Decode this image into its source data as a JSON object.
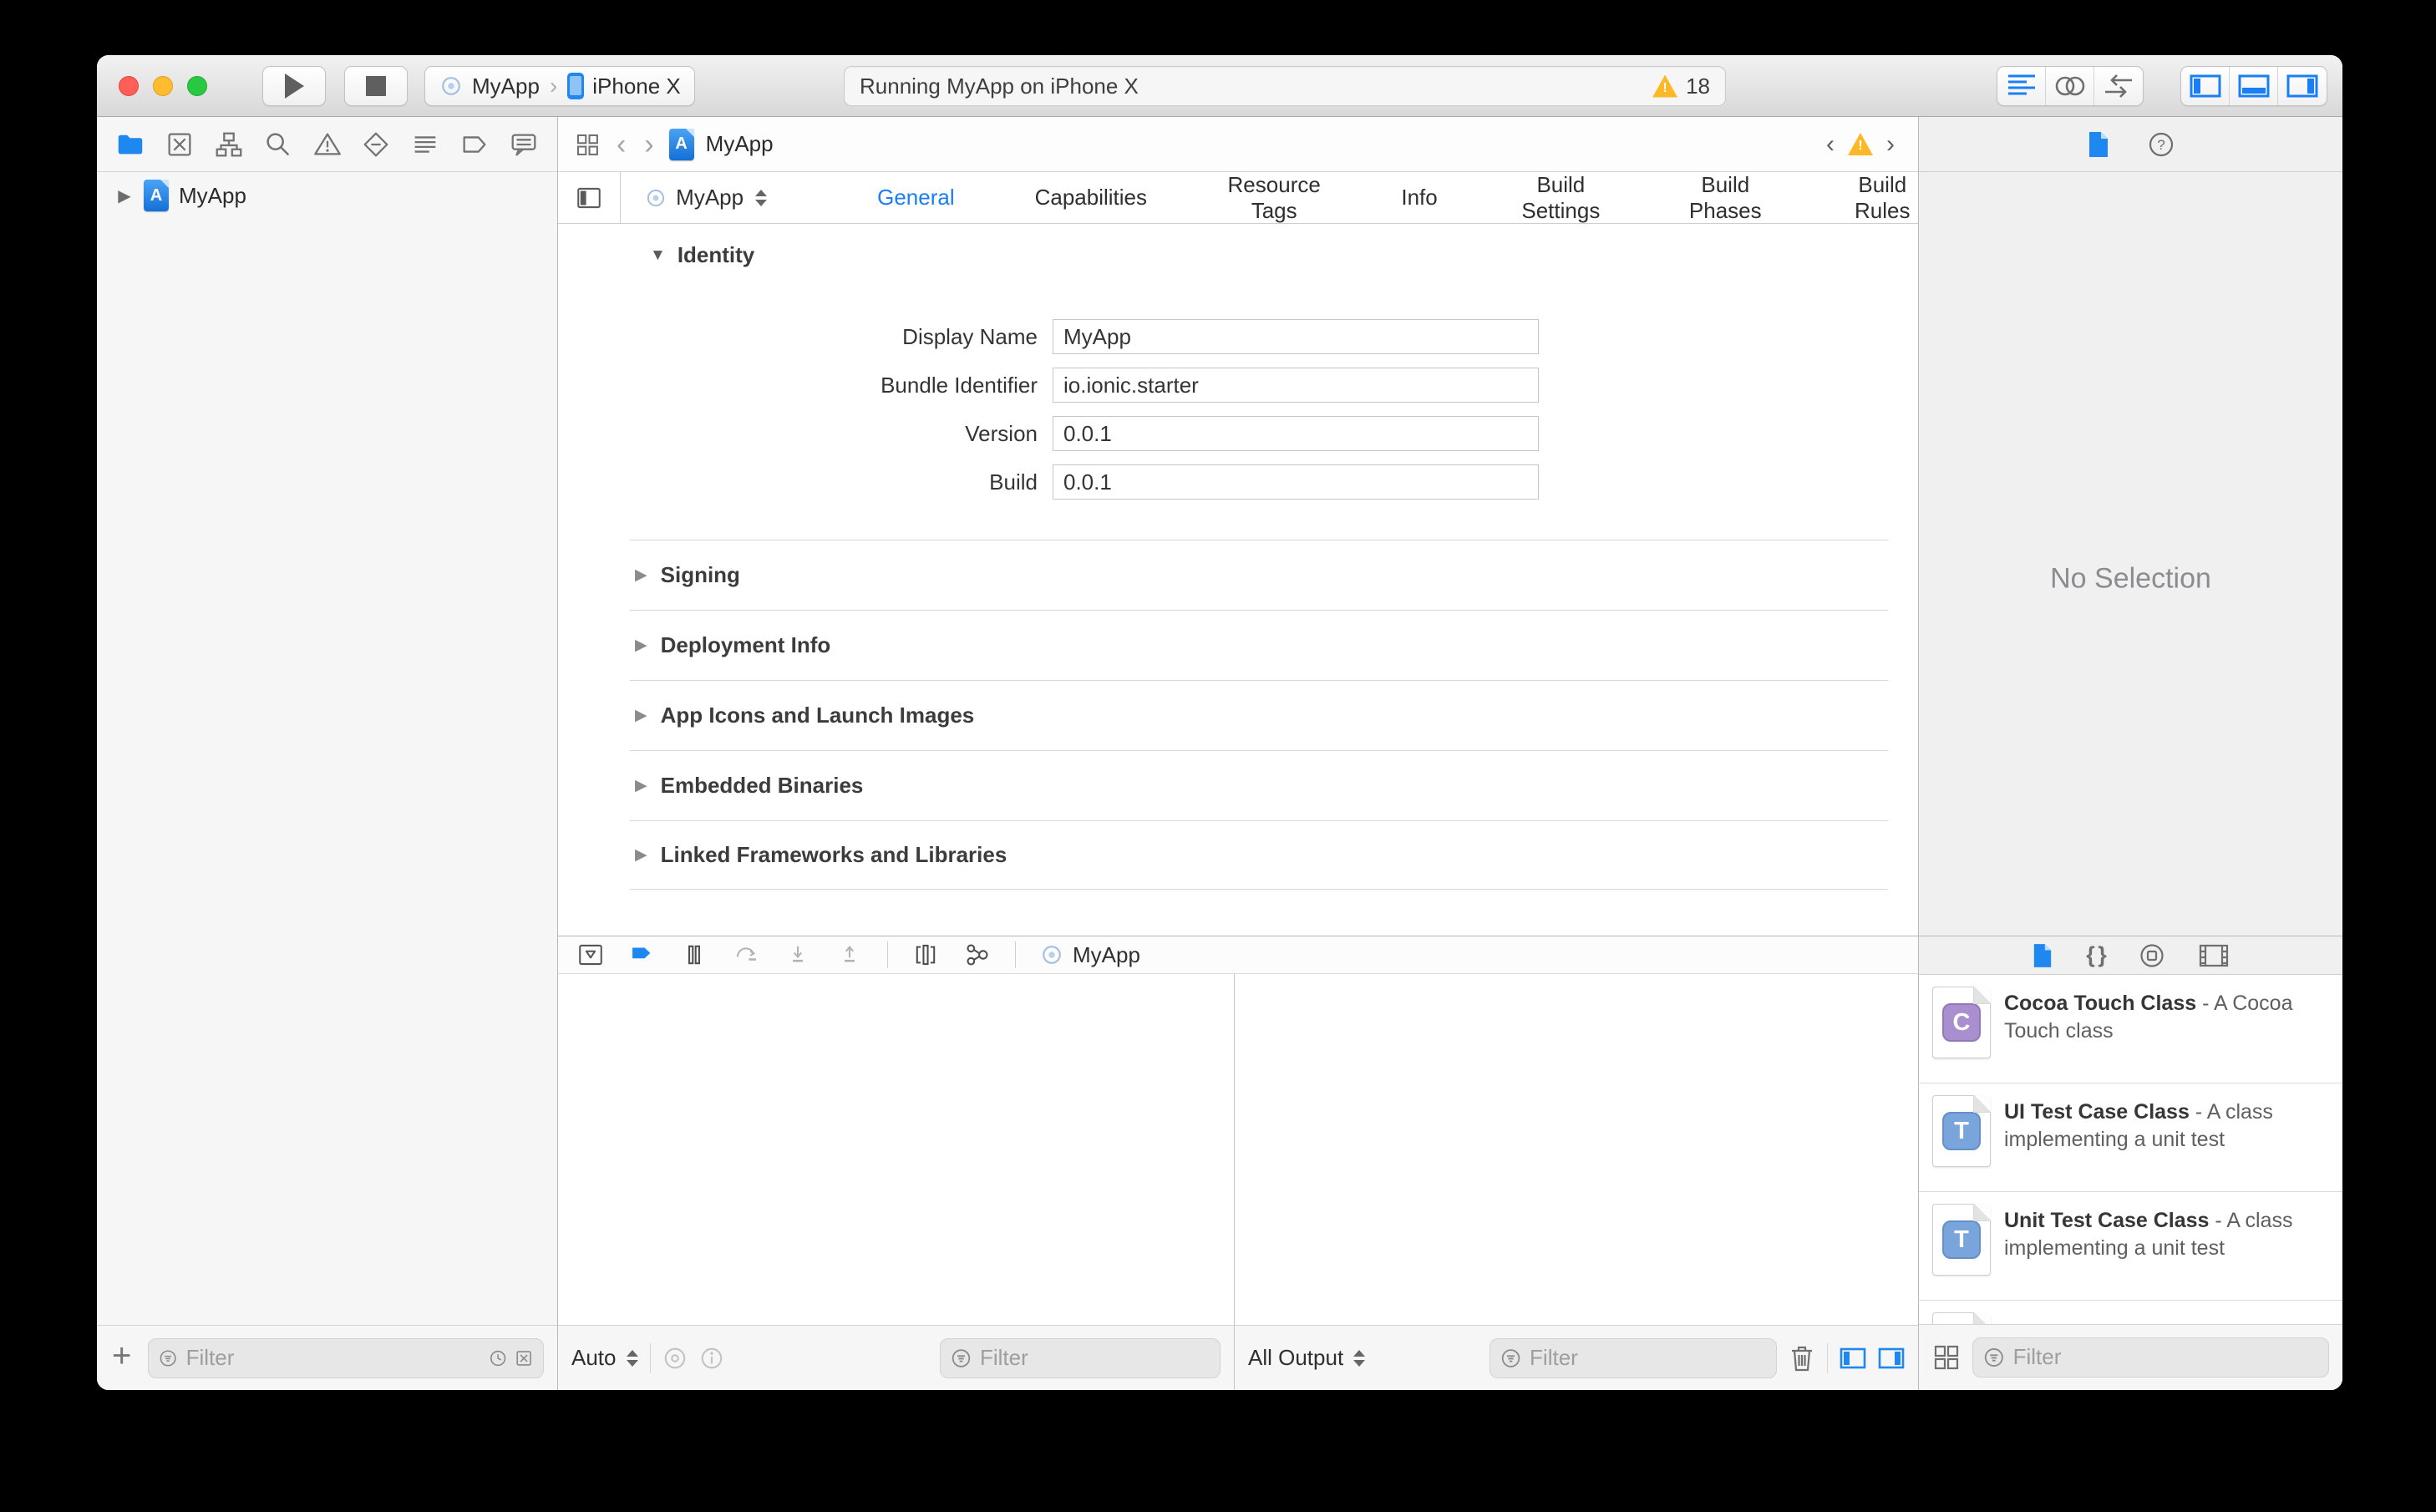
{
  "titlebar": {
    "scheme": {
      "project": "MyApp",
      "device": "iPhone X"
    },
    "status": {
      "message": "Running MyApp on iPhone X",
      "warning_count": "18"
    }
  },
  "navigator": {
    "project_name": "MyApp",
    "filter_placeholder": "Filter"
  },
  "jumpbar": {
    "file": "MyApp"
  },
  "editor": {
    "target_name": "MyApp",
    "tabs": [
      {
        "label": "General"
      },
      {
        "label": "Capabilities"
      },
      {
        "label": "Resource Tags"
      },
      {
        "label": "Info"
      },
      {
        "label": "Build Settings"
      },
      {
        "label": "Build Phases"
      },
      {
        "label": "Build Rules"
      }
    ],
    "identity": {
      "title": "Identity",
      "fields": [
        {
          "label": "Display Name",
          "value": "MyApp"
        },
        {
          "label": "Bundle Identifier",
          "value": "io.ionic.starter"
        },
        {
          "label": "Version",
          "value": "0.0.1"
        },
        {
          "label": "Build",
          "value": "0.0.1"
        }
      ]
    },
    "sections": [
      "Signing",
      "Deployment Info",
      "App Icons and Launch Images",
      "Embedded Binaries",
      "Linked Frameworks and Libraries"
    ]
  },
  "debug": {
    "process_name": "MyApp",
    "variables_scope": "Auto",
    "console_scope": "All Output",
    "variables_filter_placeholder": "Filter",
    "console_filter_placeholder": "Filter"
  },
  "inspector": {
    "empty_message": "No Selection"
  },
  "library": {
    "items": [
      {
        "letter": "C",
        "title": "Cocoa Touch Class",
        "description": "- A Cocoa Touch class"
      },
      {
        "letter": "T",
        "title": "UI Test Case Class",
        "description": "- A class implementing a unit test"
      },
      {
        "letter": "T",
        "title": "Unit Test Case Class",
        "description": "- A class implementing a unit test"
      }
    ],
    "filter_placeholder": "Filter"
  },
  "icons": {
    "plus": "+",
    "help_glyph": "?",
    "exclaim": "!",
    "braces_glyph": "{ }",
    "disclosure_open": "▼",
    "disclosure_closed": "▶",
    "chevron_left": "‹",
    "chevron_right": "›",
    "breadcrumb_separator": "›",
    "app_letter": "A"
  },
  "colors": {
    "accent": "#1a7ef5",
    "warning": "#fcb827"
  }
}
